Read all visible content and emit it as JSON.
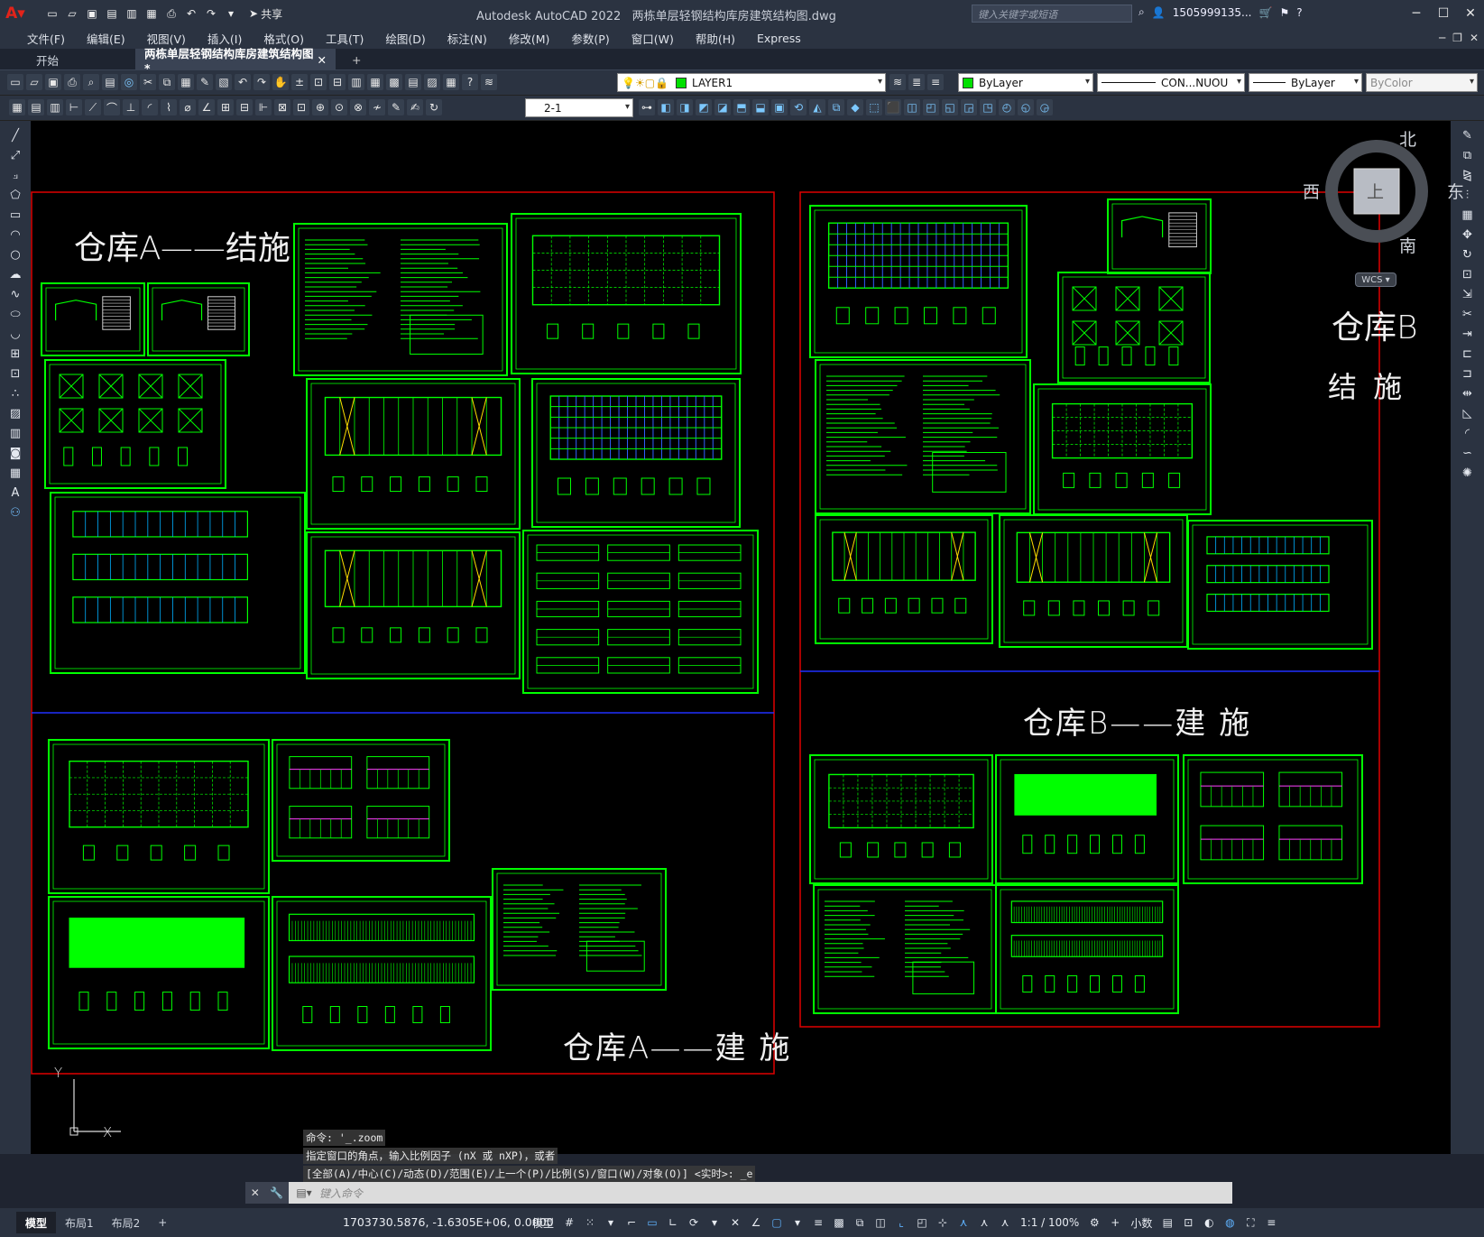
{
  "app": {
    "window_title": "Autodesk AutoCAD 2022",
    "filename": "两栋单层轻钢结构库房建筑结构图.dwg",
    "search_placeholder": "键入关键字或短语",
    "user": "1505999135...",
    "share_label": "共享"
  },
  "menu": [
    "文件(F)",
    "编辑(E)",
    "视图(V)",
    "插入(I)",
    "格式(O)",
    "工具(T)",
    "绘图(D)",
    "标注(N)",
    "修改(M)",
    "参数(P)",
    "窗口(W)",
    "帮助(H)",
    "Express"
  ],
  "tabs": {
    "start": "开始",
    "active": "两栋单层轻钢结构库房建筑结构图*",
    "close": "✕",
    "plus": "+"
  },
  "toolbar": {
    "layer": "LAYER1",
    "color": "ByLayer",
    "linetype": "CON...NUOU",
    "lineweight": "ByLayer",
    "plotstyle": "ByColor",
    "dimstyle": "2-1"
  },
  "drawing": {
    "label_a_struct": "仓库A——结施",
    "label_b_struct_1": "仓库B",
    "label_b_struct_2": "结  施",
    "label_b_arch": "仓库B——建 施",
    "label_a_arch": "仓库A——建 施"
  },
  "viewcube": {
    "north": "北",
    "south": "南",
    "east": "东",
    "west": "西",
    "top": "上",
    "wcs": "WCS"
  },
  "ucs": {
    "x": "X",
    "y": "Y"
  },
  "command": {
    "history": [
      "命令: '_.zoom",
      "指定窗口的角点，输入比例因子 (nX 或 nXP)，或者",
      "[全部(A)/中心(C)/动态(D)/范围(E)/上一个(P)/比例(S)/窗口(W)/对象(O)] <实时>: _e"
    ],
    "placeholder": "键入命令"
  },
  "status": {
    "layouts": [
      "模型",
      "布局1",
      "布局2"
    ],
    "plus": "+",
    "coordinates": "1703730.5876, -1.6305E+06, 0.0000",
    "space": "模型",
    "scale": "1:1 / 100%",
    "units": "小数"
  },
  "colors": {
    "frame_green": "#00ff00",
    "border_red": "#e00000",
    "divider_blue": "#2030ff",
    "accent_blue": "#0f5fd0",
    "canvas": "#000000"
  }
}
